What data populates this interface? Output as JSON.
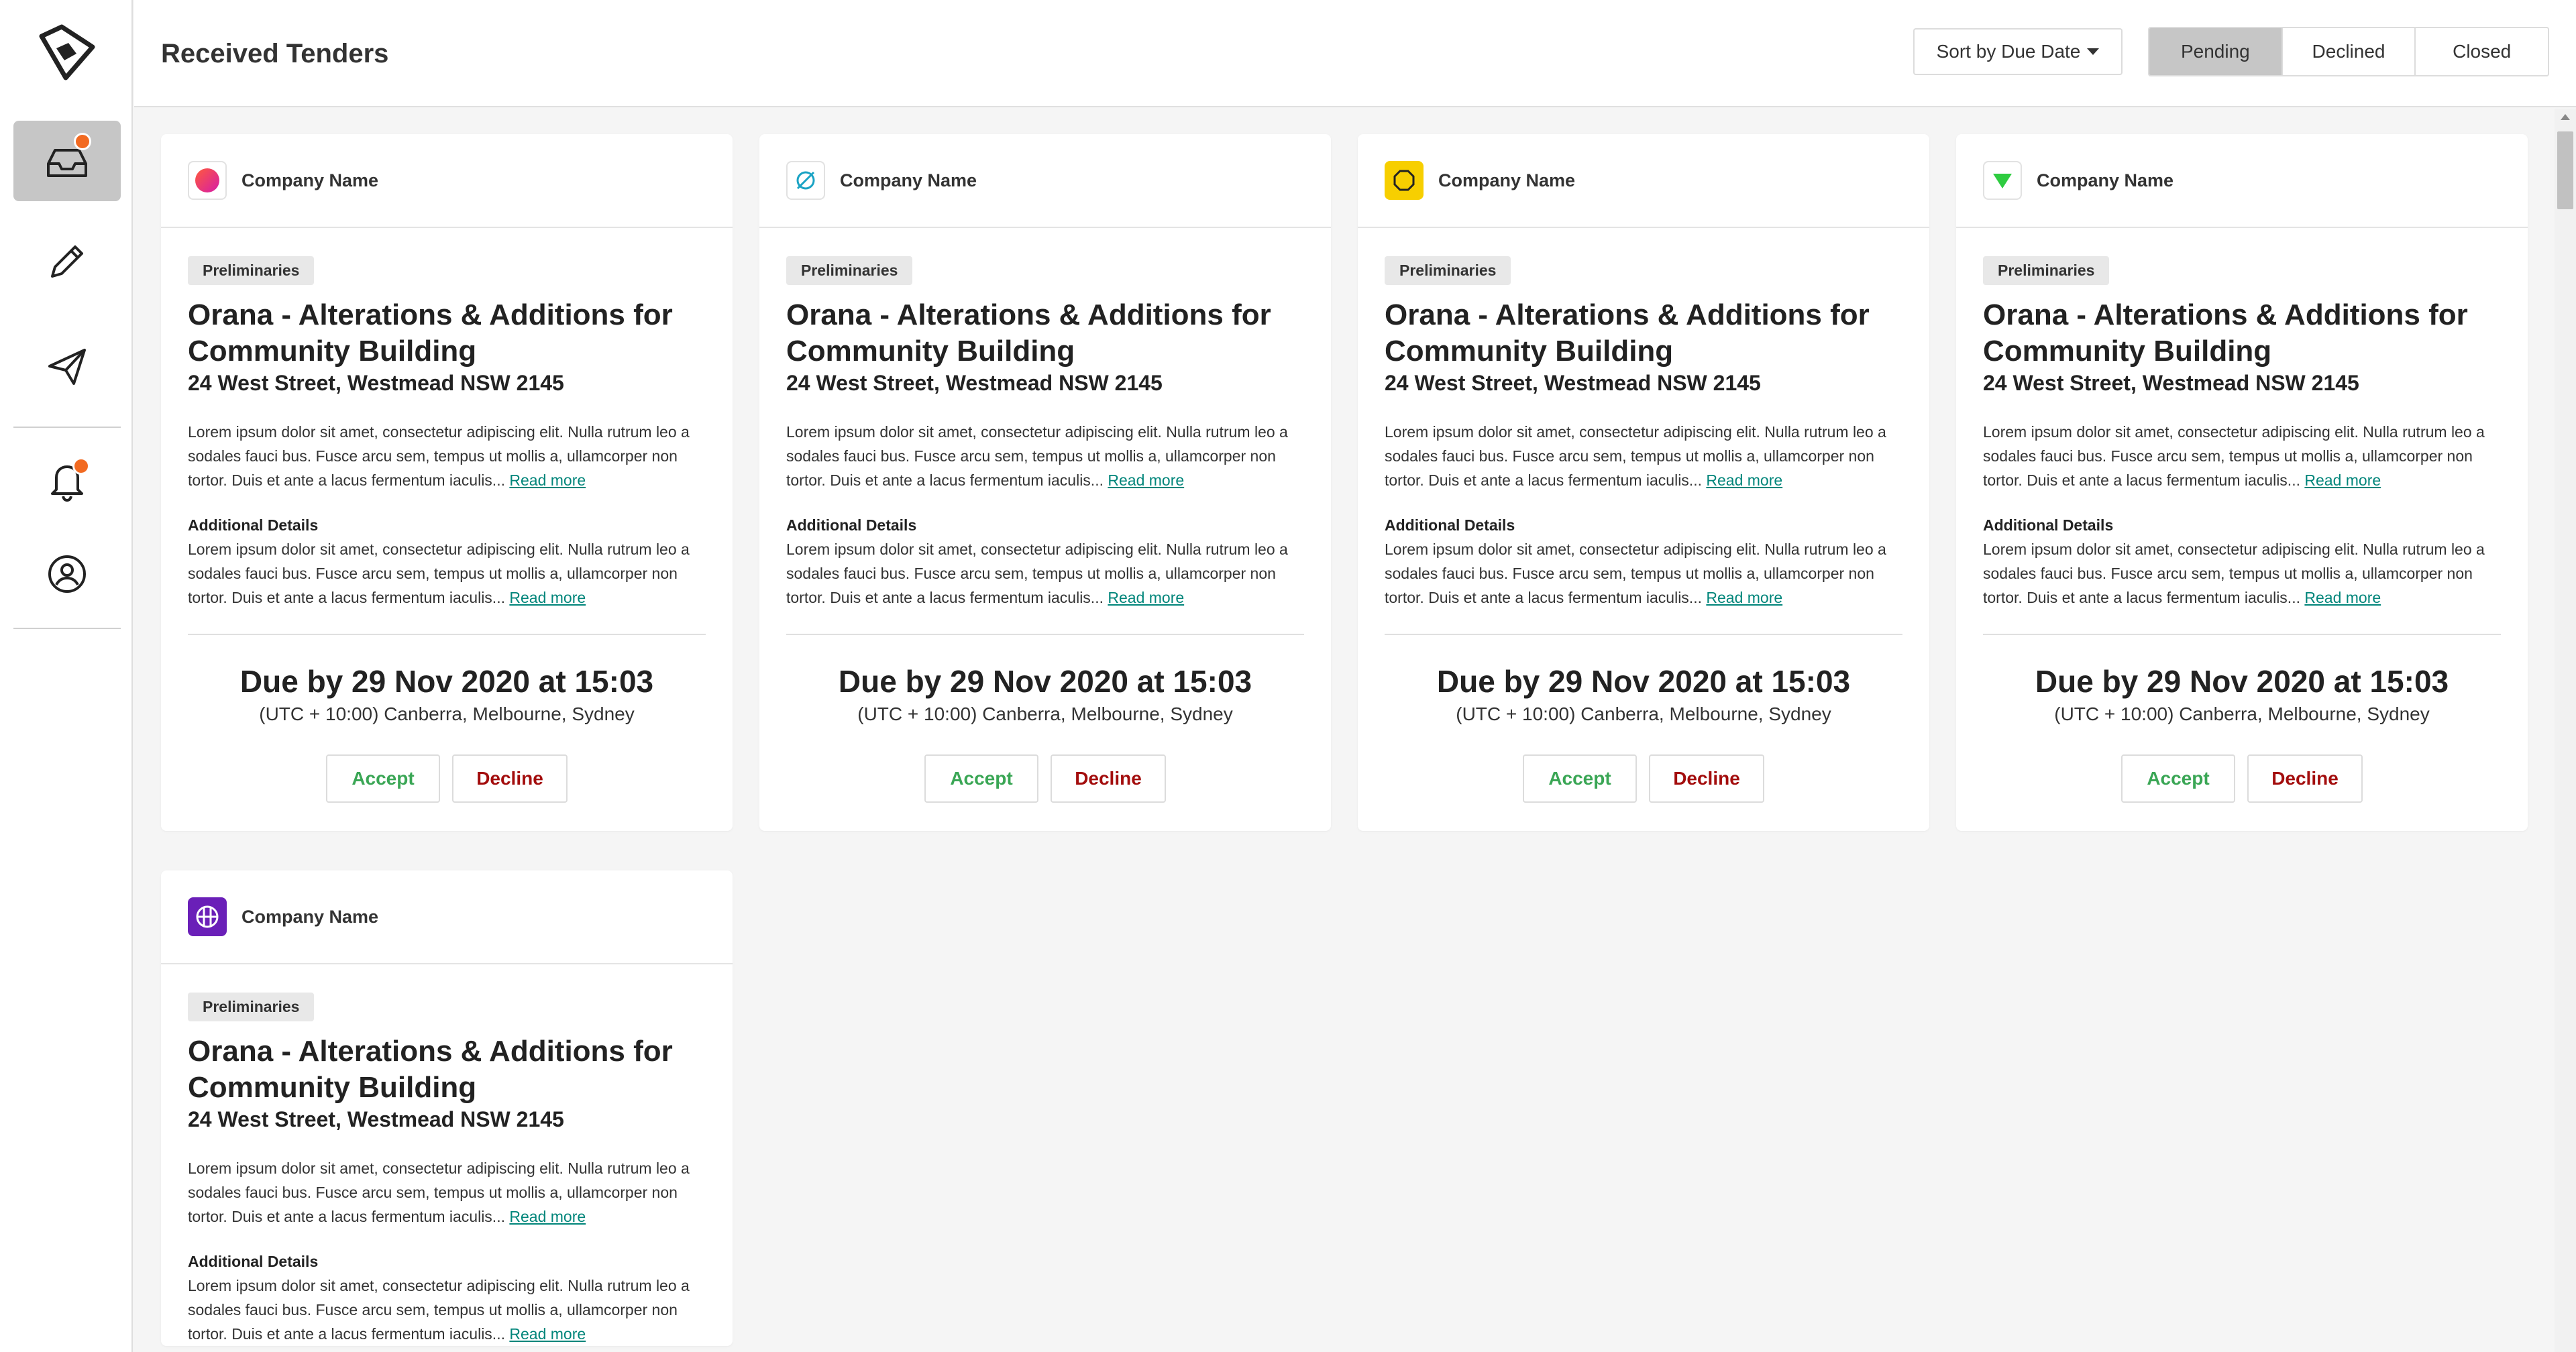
{
  "header": {
    "title": "Received Tenders",
    "sort_label": "Sort by Due Date",
    "tabs": [
      {
        "label": "Pending",
        "active": true
      },
      {
        "label": "Declined",
        "active": false
      },
      {
        "label": "Closed",
        "active": false
      }
    ]
  },
  "sidebar": {
    "items": [
      {
        "icon": "inbox-icon",
        "active": true,
        "notification": true
      },
      {
        "icon": "pencil-icon",
        "active": false,
        "notification": false
      },
      {
        "icon": "paper-plane-icon",
        "active": false,
        "notification": false
      },
      {
        "icon": "bell-icon",
        "active": false,
        "notification": true
      },
      {
        "icon": "user-icon",
        "active": false,
        "notification": false
      }
    ]
  },
  "colors": {
    "notification": "#f26a21",
    "accept": "#3aa655",
    "decline": "#a30d0d",
    "link": "#00857a",
    "active_bg": "#c6c6c6"
  },
  "cards": [
    {
      "company": "Company Name",
      "logo": "pink-circle-logo",
      "badge": "Preliminaries",
      "title": "Orana - Alterations & Additions for Community Building",
      "address": "24 West Street, Westmead NSW 2145",
      "description": "Lorem ipsum dolor sit amet, consectetur adipiscing elit. Nulla rutrum leo a sodales fauci bus. Fusce arcu sem, tempus ut mollis a, ullamcorper non tortor. Duis et ante a lacus fermentum iaculis...",
      "read_more": "Read more",
      "additional_label": "Additional Details",
      "additional_text": "Lorem ipsum dolor sit amet, consectetur adipiscing elit. Nulla rutrum leo a sodales fauci bus. Fusce arcu sem, tempus ut mollis a, ullamcorper non tortor. Duis et ante a lacus fermentum iaculis...",
      "additional_read_more": "Read more",
      "due": "Due by 29 Nov 2020 at 15:03",
      "timezone": "(UTC + 10:00) Canberra, Melbourne, Sydney",
      "accept_label": "Accept",
      "decline_label": "Decline"
    },
    {
      "company": "Company Name",
      "logo": "teal-no-signal-logo",
      "badge": "Preliminaries",
      "title": "Orana - Alterations & Additions for Community Building",
      "address": "24 West Street, Westmead NSW 2145",
      "description": "Lorem ipsum dolor sit amet, consectetur adipiscing elit. Nulla rutrum leo a sodales fauci bus. Fusce arcu sem, tempus ut mollis a, ullamcorper non tortor. Duis et ante a lacus fermentum iaculis...",
      "read_more": "Read more",
      "additional_label": "Additional Details",
      "additional_text": "Lorem ipsum dolor sit amet, consectetur adipiscing elit. Nulla rutrum leo a sodales fauci bus. Fusce arcu sem, tempus ut mollis a, ullamcorper non tortor. Duis et ante a lacus fermentum iaculis...",
      "additional_read_more": "Read more",
      "due": "Due by 29 Nov 2020 at 15:03",
      "timezone": "(UTC + 10:00) Canberra, Melbourne, Sydney",
      "accept_label": "Accept",
      "decline_label": "Decline"
    },
    {
      "company": "Company Name",
      "logo": "yellow-octagon-logo",
      "badge": "Preliminaries",
      "title": "Orana - Alterations & Additions for Community Building",
      "address": "24 West Street, Westmead NSW 2145",
      "description": "Lorem ipsum dolor sit amet, consectetur adipiscing elit. Nulla rutrum leo a sodales fauci bus. Fusce arcu sem, tempus ut mollis a, ullamcorper non tortor. Duis et ante a lacus fermentum iaculis...",
      "read_more": "Read more",
      "additional_label": "Additional Details",
      "additional_text": "Lorem ipsum dolor sit amet, consectetur adipiscing elit. Nulla rutrum leo a sodales fauci bus. Fusce arcu sem, tempus ut mollis a, ullamcorper non tortor. Duis et ante a lacus fermentum iaculis...",
      "additional_read_more": "Read more",
      "due": "Due by 29 Nov 2020 at 15:03",
      "timezone": "(UTC + 10:00) Canberra, Melbourne, Sydney",
      "accept_label": "Accept",
      "decline_label": "Decline"
    },
    {
      "company": "Company Name",
      "logo": "green-triangle-logo",
      "badge": "Preliminaries",
      "title": "Orana - Alterations & Additions for Community Building",
      "address": "24 West Street, Westmead NSW 2145",
      "description": "Lorem ipsum dolor sit amet, consectetur adipiscing elit. Nulla rutrum leo a sodales fauci bus. Fusce arcu sem, tempus ut mollis a, ullamcorper non tortor. Duis et ante a lacus fermentum iaculis...",
      "read_more": "Read more",
      "additional_label": "Additional Details",
      "additional_text": "Lorem ipsum dolor sit amet, consectetur adipiscing elit. Nulla rutrum leo a sodales fauci bus. Fusce arcu sem, tempus ut mollis a, ullamcorper non tortor. Duis et ante a lacus fermentum iaculis...",
      "additional_read_more": "Read more",
      "due": "Due by 29 Nov 2020 at 15:03",
      "timezone": "(UTC + 10:00) Canberra, Melbourne, Sydney",
      "accept_label": "Accept",
      "decline_label": "Decline"
    },
    {
      "company": "Company Name",
      "logo": "purple-grid-logo",
      "badge": "Preliminaries",
      "title": "Orana - Alterations & Additions for Community Building",
      "address": "24 West Street, Westmead NSW 2145",
      "description": "Lorem ipsum dolor sit amet, consectetur adipiscing elit. Nulla rutrum leo a sodales fauci bus. Fusce arcu sem, tempus ut mollis a, ullamcorper non tortor. Duis et ante a lacus fermentum iaculis...",
      "read_more": "Read more",
      "additional_label": "Additional Details",
      "additional_text": "Lorem ipsum dolor sit amet, consectetur adipiscing elit. Nulla rutrum leo a sodales fauci bus. Fusce arcu sem, tempus ut mollis a, ullamcorper non tortor. Duis et ante a lacus fermentum iaculis...",
      "additional_read_more": "Read more"
    }
  ]
}
